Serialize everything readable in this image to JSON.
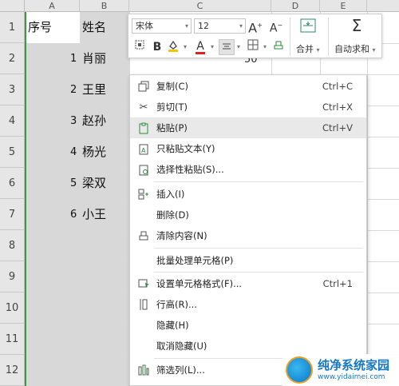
{
  "columns": [
    "A",
    "B",
    "C",
    "D",
    "E"
  ],
  "rows": [
    "1",
    "2",
    "3",
    "4",
    "5",
    "6",
    "7",
    "8",
    "9",
    "10",
    "11",
    "12"
  ],
  "header": {
    "a1": "序号",
    "b1": "姓名"
  },
  "table": [
    {
      "num": "1",
      "name": "肖丽"
    },
    {
      "num": "2",
      "name": "王里"
    },
    {
      "num": "3",
      "name": "赵孙"
    },
    {
      "num": "4",
      "name": "杨光"
    },
    {
      "num": "5",
      "name": "梁双"
    },
    {
      "num": "6",
      "name": "小王"
    }
  ],
  "c2_value": "50",
  "toolbar": {
    "font_name": "宋体",
    "font_size": "12",
    "grow_font": "A",
    "shrink_font": "A",
    "bold": "B",
    "font_color": "A",
    "merge_label": "合并",
    "autosum_label": "自动求和"
  },
  "menu": {
    "items": [
      {
        "label": "复制(C)",
        "shortcut": "Ctrl+C",
        "icon": "copy-icon"
      },
      {
        "label": "剪切(T)",
        "shortcut": "Ctrl+X",
        "icon": "cut-icon"
      },
      {
        "label": "粘贴(P)",
        "shortcut": "Ctrl+V",
        "icon": "paste-icon",
        "highlighted": true
      },
      {
        "label": "只粘贴文本(Y)",
        "shortcut": "",
        "icon": "paste-text-icon"
      },
      {
        "label": "选择性粘贴(S)...",
        "shortcut": "",
        "icon": "paste-special-icon"
      },
      {
        "label": "插入(I)",
        "shortcut": "",
        "icon": "insert-icon"
      },
      {
        "label": "删除(D)",
        "shortcut": "",
        "icon": ""
      },
      {
        "label": "清除内容(N)",
        "shortcut": "",
        "icon": "eraser-icon"
      },
      {
        "label": "批量处理单元格(P)",
        "shortcut": "",
        "icon": ""
      },
      {
        "label": "设置单元格格式(F)...",
        "shortcut": "Ctrl+1",
        "icon": "format-cells-icon"
      },
      {
        "label": "行高(R)...",
        "shortcut": "",
        "icon": "row-height-icon"
      },
      {
        "label": "隐藏(H)",
        "shortcut": "",
        "icon": ""
      },
      {
        "label": "取消隐藏(U)",
        "shortcut": "",
        "icon": ""
      },
      {
        "label": "筛选列(L)...",
        "shortcut": "",
        "icon": "filter-column-icon"
      }
    ]
  },
  "watermark": {
    "title": "纯净系统家园",
    "url": "www.yidaimei.com"
  },
  "colors": {
    "accent_green": "#3a9a4a",
    "selection_gray": "#d8d8d8",
    "watermark_blue": "#1678c8"
  }
}
